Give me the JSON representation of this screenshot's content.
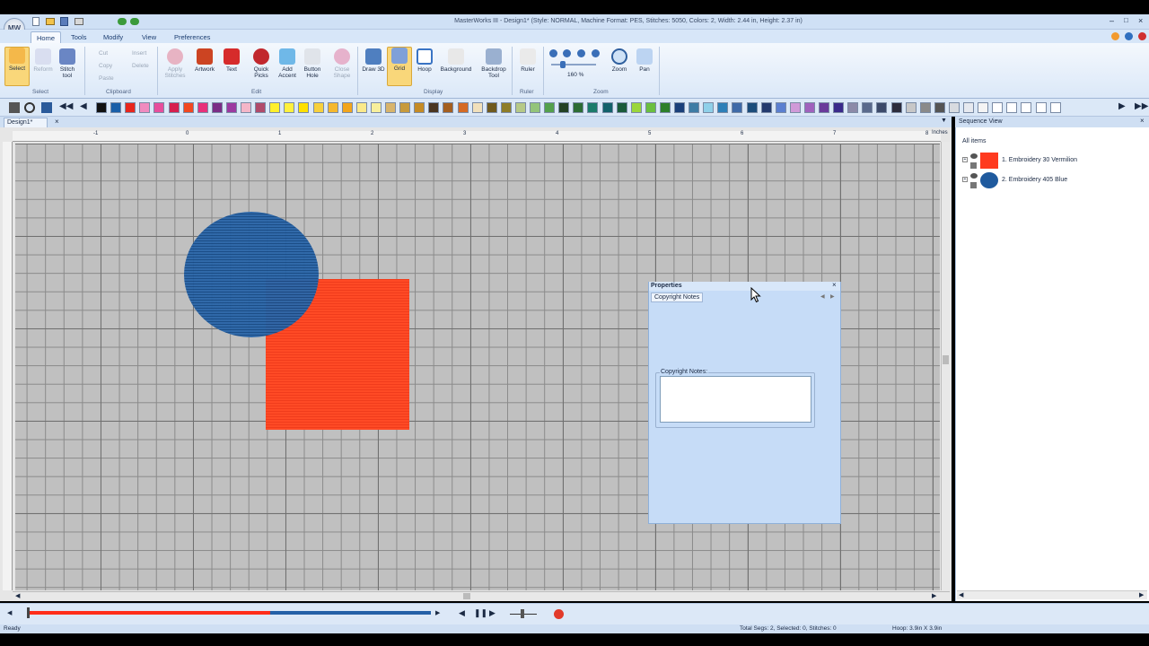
{
  "window": {
    "title": "MasterWorks III - Design1* (Style: NORMAL, Machine Format: PES, Stitches: 5050, Colors: 2, Width: 2.44 in, Height: 2.37 in)"
  },
  "tabs": [
    "Home",
    "Tools",
    "Modify",
    "View",
    "Preferences"
  ],
  "ribbon": {
    "select": {
      "label": "Select"
    },
    "reform": {
      "label": "Reform"
    },
    "stitch_tool": {
      "label": "Stitch tool"
    },
    "cut": "Cut",
    "copy": "Copy",
    "paste": "Paste",
    "insert": "Insert",
    "delete": "Delete",
    "apply_stitches": "Apply Stitches",
    "artwork": "Artwork",
    "text": "Text",
    "quick_picks": "Quick Picks",
    "add_accent": "Add Accent",
    "button_hole": "Button Hole",
    "close_shape": "Close Shape",
    "draw_3d": "Draw 3D",
    "grid": "Grid",
    "hoop": "Hoop",
    "background": "Background",
    "backdrop_tool": "Backdrop Tool",
    "ruler": "Ruler",
    "zoom_level": "160 %",
    "zoom": "Zoom",
    "pan": "Pan",
    "groups": {
      "select": "Select",
      "clipboard": "Clipboard",
      "edit": "Edit",
      "display": "Display",
      "ruler": "Ruler",
      "zoom": "Zoom"
    }
  },
  "palette": [
    "#111111",
    "#1a5fa8",
    "#e8261c",
    "#f08bbf",
    "#e74e9c",
    "#d61f4e",
    "#f2471f",
    "#e8307a",
    "#7b2d86",
    "#9c3aa0",
    "#f4b6c8",
    "#b04a6a",
    "#ffef2a",
    "#fff03d",
    "#ffe000",
    "#f7d03c",
    "#f5b82e",
    "#f2a51c",
    "#fbe98a",
    "#f7ef9c",
    "#d8b46b",
    "#c79a3c",
    "#c58b25",
    "#4a3520",
    "#a45f20",
    "#d56a24",
    "#f1e0bb",
    "#6f5a1e",
    "#8e7d28",
    "#b6c987",
    "#93c47a",
    "#54a04c",
    "#244225",
    "#2d6c34",
    "#1b7b6a",
    "#12606a",
    "#1a5a3a",
    "#9bd63b",
    "#6bbf3f",
    "#2d7f2a",
    "#1a3f7a",
    "#3e7ca5",
    "#8fd0e9",
    "#2d7fb8",
    "#3f6aa8",
    "#1b4c7a",
    "#233a6e",
    "#5b7fd0",
    "#d09ad8",
    "#a062bd",
    "#6a3a9a",
    "#3a2a8a",
    "#8c8aa8",
    "#5a6a8c",
    "#3c4a6a",
    "#2c2c3c",
    "#c7c7c7",
    "#8a8a8a",
    "#555555",
    "#d8dbe0",
    "#e6e9ef",
    "#f4f4f4",
    "#ffffff",
    "#ffffff",
    "#ffffff",
    "#ffffff",
    "#ffffff"
  ],
  "doc_tab": "Design1*",
  "ruler": {
    "unit": "Inches",
    "h_ticks": [
      "-1",
      "0",
      "1",
      "2",
      "3",
      "4",
      "5",
      "6",
      "7",
      "8"
    ]
  },
  "properties": {
    "title": "Properties",
    "tab": "Copyright Notes",
    "notes_label": "Copyright Notes:",
    "notes_value": ""
  },
  "sequence": {
    "title": "Sequence View",
    "all_items": "All items",
    "items": [
      {
        "label": "1. Embroidery 30 Vermilion",
        "color": "#ff3a1f"
      },
      {
        "label": "2. Embroidery 405 Blue",
        "color": "#1f5a9e"
      }
    ]
  },
  "progress": {
    "total_fraction": 1.0,
    "played_fraction": 0.6
  },
  "status": {
    "left": "Ready",
    "middle": "Total Segs: 2, Selected: 0, Stitches: 0",
    "right": "Hoop: 3.9in X 3.9in"
  }
}
